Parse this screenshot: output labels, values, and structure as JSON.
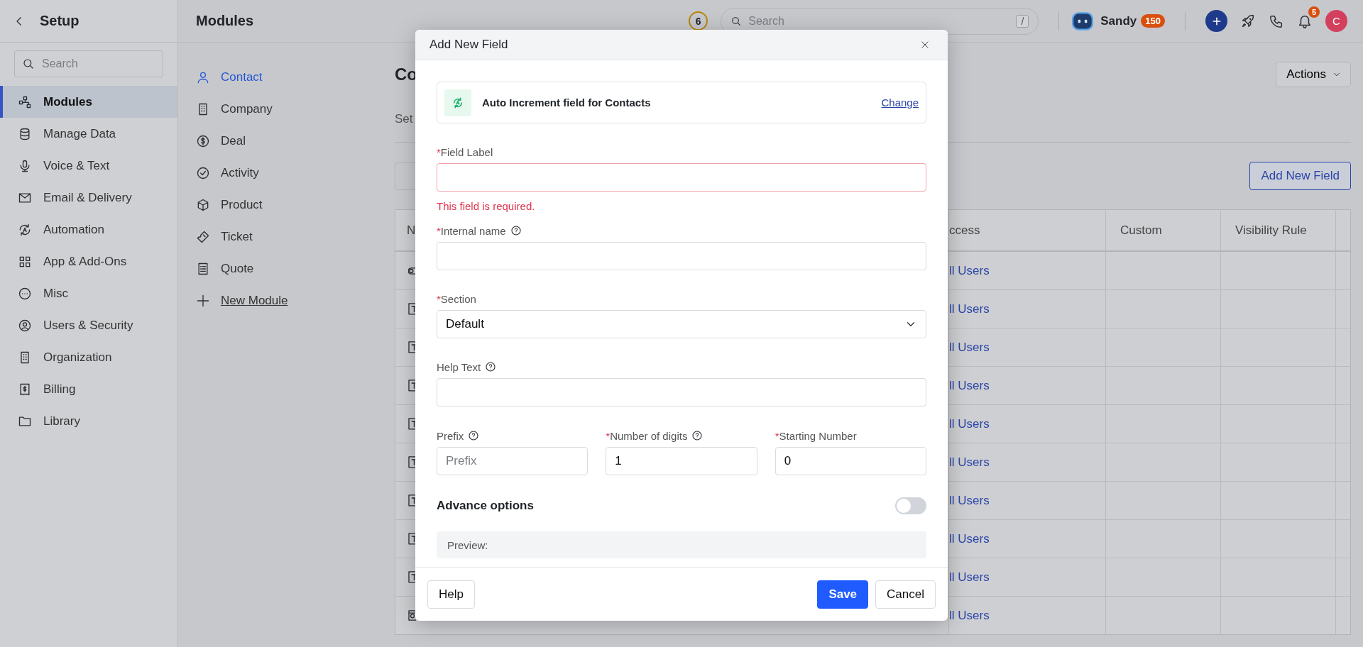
{
  "sidebar": {
    "title": "Setup",
    "search": {
      "placeholder": "Search"
    },
    "items": [
      {
        "label": "Modules",
        "selected": true
      },
      {
        "label": "Manage Data",
        "selected": false
      },
      {
        "label": "Voice & Text",
        "selected": false
      },
      {
        "label": "Email & Delivery",
        "selected": false
      },
      {
        "label": "Automation",
        "selected": false
      },
      {
        "label": "App & Add-Ons",
        "selected": false
      },
      {
        "label": "Misc",
        "selected": false
      },
      {
        "label": "Users & Security",
        "selected": false
      },
      {
        "label": "Organization",
        "selected": false
      },
      {
        "label": "Billing",
        "selected": false
      },
      {
        "label": "Library",
        "selected": false
      }
    ]
  },
  "header": {
    "title": "Modules",
    "count_badge": "6",
    "search": {
      "placeholder": "Search",
      "shortcut": "/"
    },
    "user": {
      "name": "Sandy",
      "points": "150"
    },
    "notifications": "5",
    "avatar": "C"
  },
  "modules": {
    "items": [
      {
        "label": "Contact",
        "selected": true
      },
      {
        "label": "Company",
        "selected": false
      },
      {
        "label": "Deal",
        "selected": false
      },
      {
        "label": "Activity",
        "selected": false
      },
      {
        "label": "Product",
        "selected": false
      },
      {
        "label": "Ticket",
        "selected": false
      },
      {
        "label": "Quote",
        "selected": false
      }
    ],
    "new_module": "New Module"
  },
  "content": {
    "title": "Co",
    "tab": "Set",
    "actions": "Actions",
    "add_button": "Add New Field",
    "table": {
      "columns": [
        "N",
        "ccess",
        "Custom",
        "Visibility Rule"
      ],
      "rows": [
        {
          "kind": "toggle",
          "access": "ll Users"
        },
        {
          "kind": "text",
          "access": "ll Users"
        },
        {
          "kind": "text",
          "access": "ll Users"
        },
        {
          "kind": "text",
          "access": "ll Users"
        },
        {
          "kind": "text",
          "access": "ll Users"
        },
        {
          "kind": "text",
          "access": "ll Users"
        },
        {
          "kind": "text",
          "access": "ll Users"
        },
        {
          "kind": "text",
          "access": "ll Users"
        },
        {
          "kind": "text",
          "access": "ll Users"
        },
        {
          "kind": "image",
          "access": "ll Users"
        }
      ]
    }
  },
  "dialog": {
    "title": "Add New Field",
    "type_card": {
      "label": "Auto Increment field for Contacts",
      "link": "Change"
    },
    "fields": [
      {
        "kind": "input",
        "mark": "*",
        "label": "Field Label",
        "help": false,
        "error": "This field is required."
      },
      {
        "kind": "input",
        "mark": "*",
        "label": "Internal name",
        "help": true
      },
      {
        "kind": "select",
        "mark": "*",
        "label": "Section",
        "help": false,
        "value": "Default"
      },
      {
        "kind": "input",
        "label": "Help Text",
        "help": true
      }
    ],
    "numbering": [
      {
        "label": "Prefix",
        "help": true,
        "placeholder": "Prefix"
      },
      {
        "mark": "*",
        "label": "Number of digits",
        "help": true,
        "value": "1"
      },
      {
        "mark": "*",
        "label": "Starting Number",
        "help": false,
        "value": "0"
      }
    ],
    "advance": {
      "label": "Advance options",
      "on": false
    },
    "preview": "Preview:",
    "buttons": {
      "help": "Help",
      "save": "Save",
      "cancel": "Cancel"
    }
  }
}
